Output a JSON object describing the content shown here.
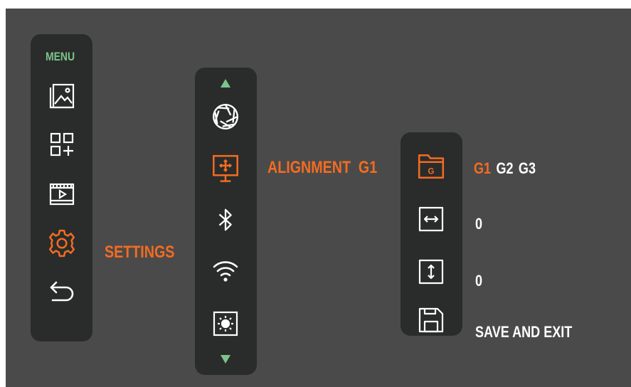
{
  "colors": {
    "accent": "#f36c21",
    "menu_title": "#7cc48a",
    "icon": "#ffffff",
    "panel": "#2a2c2b",
    "background": "#4a4a4a"
  },
  "main_menu": {
    "title": "MENU",
    "items": [
      {
        "icon": "gallery-icon"
      },
      {
        "icon": "add-widget-icon"
      },
      {
        "icon": "video-icon"
      },
      {
        "icon": "gear-icon",
        "selected": true,
        "label": "SETTINGS"
      },
      {
        "icon": "back-icon"
      }
    ]
  },
  "settings_menu": {
    "items": [
      {
        "icon": "aperture-icon"
      },
      {
        "icon": "alignment-icon",
        "selected": true,
        "label": "ALIGNMENT  G1"
      },
      {
        "icon": "bluetooth-icon"
      },
      {
        "icon": "wifi-icon"
      },
      {
        "icon": "brightness-icon"
      }
    ]
  },
  "alignment_menu": {
    "profile_icon_text": "G",
    "profiles": [
      "G1",
      "G2",
      "G3"
    ],
    "selected_profile": "G1",
    "horizontal_value": "0",
    "vertical_value": "0",
    "save_label": "SAVE AND EXIT"
  }
}
